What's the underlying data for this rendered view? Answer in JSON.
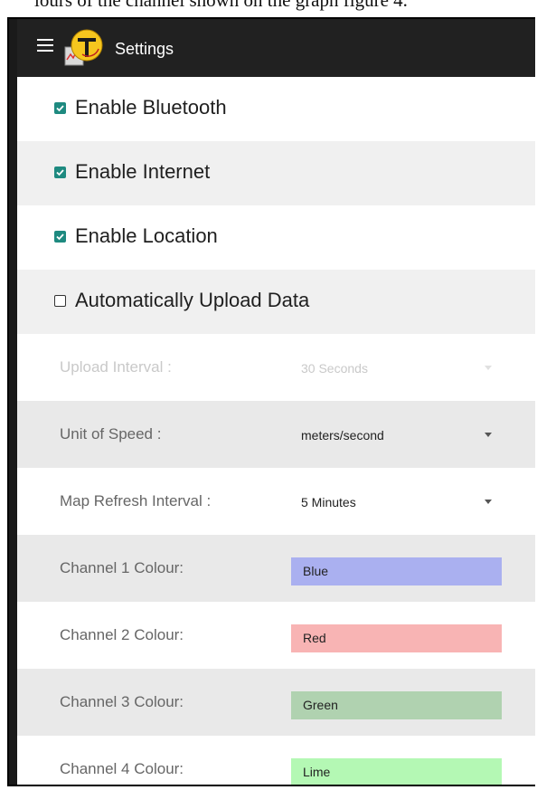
{
  "caption": "lours of the channel shown on the graph figure 4.",
  "app": {
    "title": "Settings"
  },
  "checkboxes": [
    {
      "label": "Enable Bluetooth",
      "checked": true
    },
    {
      "label": "Enable Internet",
      "checked": true
    },
    {
      "label": "Enable Location",
      "checked": true
    },
    {
      "label": "Automatically Upload Data",
      "checked": false
    }
  ],
  "settings": {
    "upload_interval": {
      "label": "Upload Interval :",
      "value": "30 Seconds",
      "enabled": false
    },
    "unit_of_speed": {
      "label": "Unit of Speed :",
      "value": "meters/second",
      "enabled": true
    },
    "map_refresh": {
      "label": "Map Refresh Interval :",
      "value": "5 Minutes",
      "enabled": true
    }
  },
  "channels": [
    {
      "label": "Channel 1 Colour:",
      "value": "Blue",
      "color": "#aab0f0"
    },
    {
      "label": "Channel 2 Colour:",
      "value": "Red",
      "color": "#f8b4b4"
    },
    {
      "label": "Channel 3 Colour:",
      "value": "Green",
      "color": "#b0d2b0"
    },
    {
      "label": "Channel 4 Colour:",
      "value": "Lime",
      "color": "#b4f8b4"
    }
  ],
  "colors": {
    "toolbar": "#212121",
    "checkbox_accent": "#1e8a80"
  }
}
